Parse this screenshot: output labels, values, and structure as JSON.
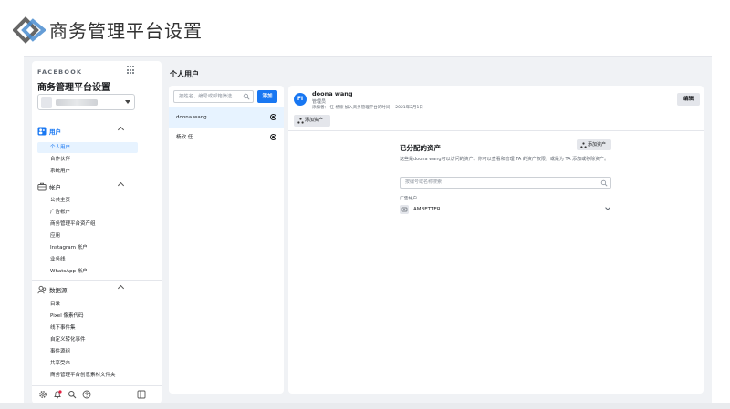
{
  "page": {
    "title": "商务管理平台设置"
  },
  "sidebar": {
    "brand": "FACEBOOK",
    "title": "商务管理平台设置",
    "sections": [
      {
        "label": "用户",
        "icon": "users-icon",
        "items": [
          "个人用户",
          "合作伙伴",
          "系统用户"
        ]
      },
      {
        "label": "帐户",
        "icon": "briefcase-icon",
        "items": [
          "公共主页",
          "广告帐户",
          "商务管理平台资产组",
          "应用",
          "Instagram 帐户",
          "业务线",
          "WhatsApp 帐户"
        ]
      },
      {
        "label": "数据源",
        "icon": "people-data-icon",
        "items": [
          "目录",
          "Pixel 像素代码",
          "线下事件集",
          "自定义转化事件",
          "事件源组",
          "共享受众",
          "商务管理平台创意素材文件夹"
        ]
      }
    ]
  },
  "main": {
    "section_title": "个人用户",
    "search_placeholder": "按姓名、编号或邮箱筛选",
    "add_label": "添加",
    "users": [
      {
        "name": "doona wang",
        "selected": true
      },
      {
        "name": "杨欣 任",
        "selected": false
      }
    ]
  },
  "detail": {
    "avatar_initials": "FI",
    "name": "doona wang",
    "role": "管理员",
    "meta": "添加者： 任 杨欣  加入商务管理平台的时间： 2021年2月1日",
    "edit_label": "编辑",
    "add_assets_tab": "添加资产",
    "assets_title": "已分配的资产",
    "add_assets_button": "添加资产",
    "assets_desc": "这些是doona wang可以访问的资产。你可以查看和管理 TA 的资产权限，或是为 TA 添加或移除资产。",
    "assets_search_placeholder": "按编号或名称搜索",
    "asset_category": "广告帐户",
    "asset_name": "AMBETTER"
  }
}
